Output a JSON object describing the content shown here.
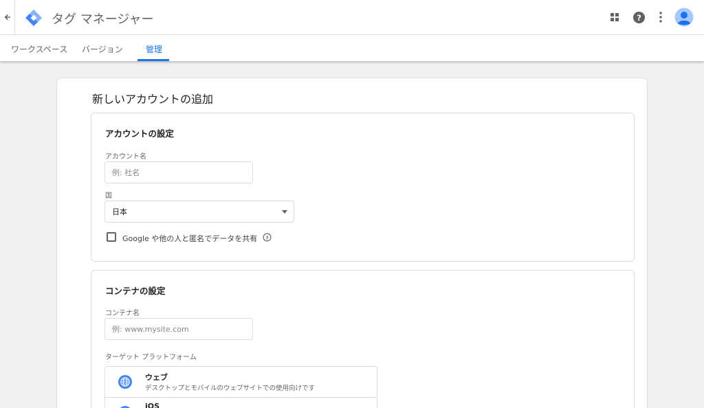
{
  "header": {
    "back_icon": "arrow-left-icon",
    "app_title": "タグ マネージャー",
    "brand_color": "#4285f4",
    "icons": [
      "apps-grid-icon",
      "help-icon",
      "more-vert-icon",
      "account-avatar-icon"
    ]
  },
  "tabs": [
    {
      "label": "ワークスペース",
      "active": false
    },
    {
      "label": "バージョン",
      "active": false
    },
    {
      "label": "管理",
      "active": true
    }
  ],
  "page": {
    "title": "新しいアカウントの追加"
  },
  "account_section": {
    "title": "アカウントの設定",
    "account_name_label": "アカウント名",
    "account_name_value": "",
    "account_name_placeholder": "例: 社名",
    "country_label": "国",
    "country_value": "日本",
    "share_label": "Google や他の人と匿名でデータを共有",
    "share_checked": false
  },
  "container_section": {
    "title": "コンテナの設定",
    "container_name_label": "コンテナ名",
    "container_name_value": "",
    "container_name_placeholder": "例: www.mysite.com",
    "platform_label": "ターゲット プラットフォーム",
    "platforms": [
      {
        "name": "ウェブ",
        "description": "デスクトップとモバイルのウェブサイトでの使用向けです",
        "icon": "globe-icon"
      },
      {
        "name": "iOS",
        "description": "",
        "icon": "ios-icon"
      }
    ]
  },
  "colors": {
    "accent": "#1a73e8",
    "platform_icon": "#4285f4"
  }
}
